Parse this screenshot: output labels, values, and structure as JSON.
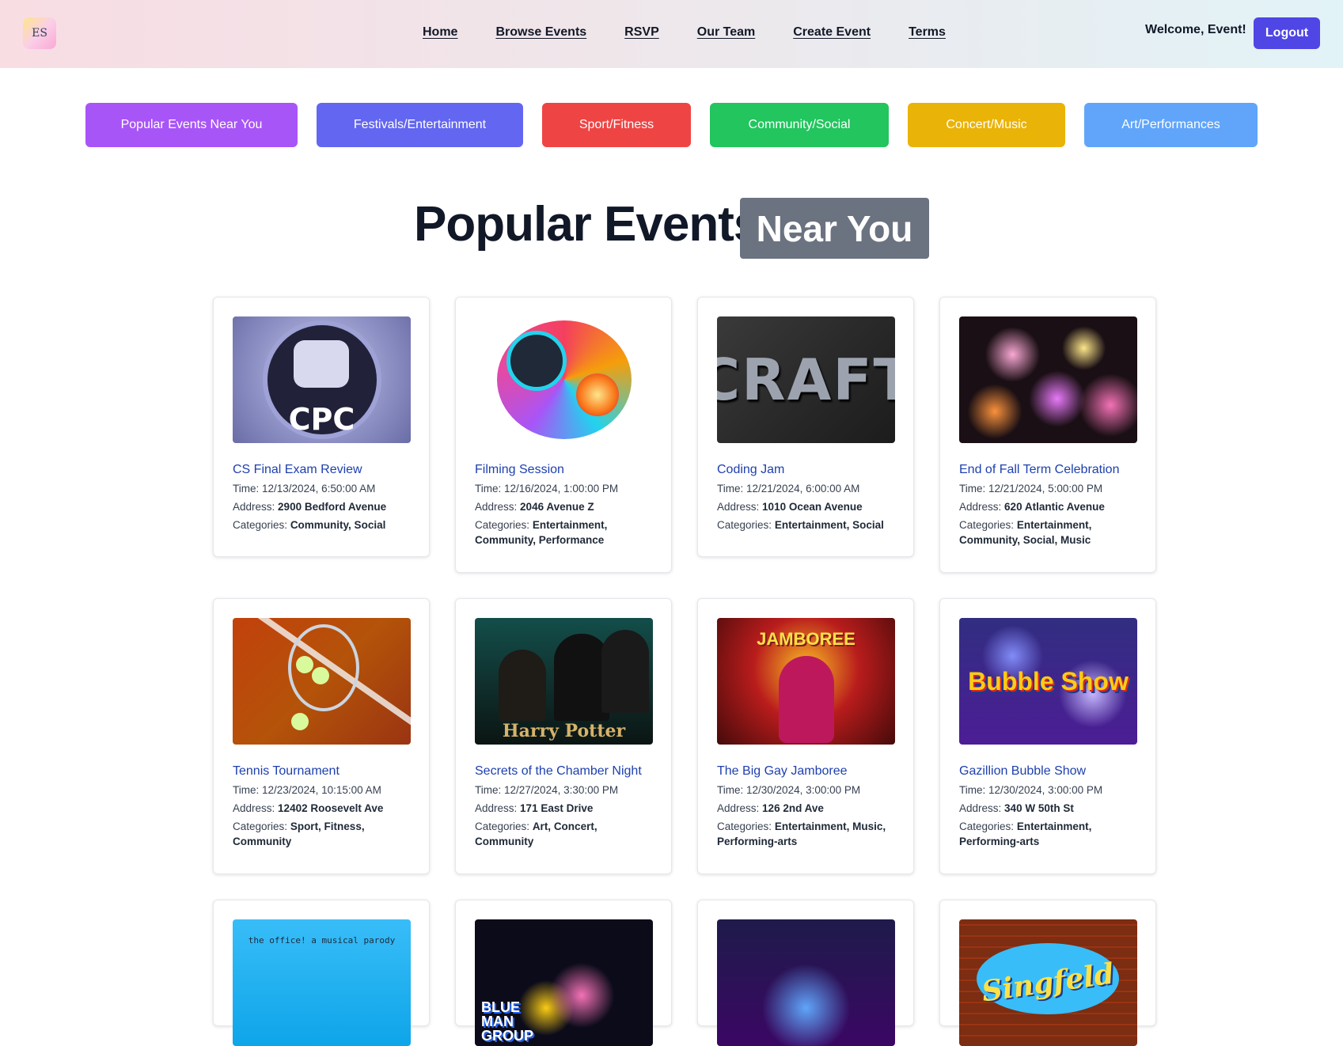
{
  "header": {
    "logo_text": "ES",
    "nav": [
      "Home",
      "Browse Events",
      "RSVP",
      "Our Team",
      "Create Event",
      "Terms"
    ],
    "welcome": "Welcome, Event!",
    "logout_label": "Logout"
  },
  "categories": [
    {
      "label": "Popular Events Near You",
      "color": "#a855f7"
    },
    {
      "label": "Festivals/Entertainment",
      "color": "#6366f1"
    },
    {
      "label": "Sport/Fitness",
      "color": "#ef4444"
    },
    {
      "label": "Community/Social",
      "color": "#22c55e"
    },
    {
      "label": "Concert/Music",
      "color": "#eab308"
    },
    {
      "label": "Art/Performances",
      "color": "#60a5fa"
    }
  ],
  "heading": {
    "main": "Popular Events",
    "badge": "Near You"
  },
  "labels": {
    "time": "Time:",
    "address": "Address:",
    "categories": "Categories:"
  },
  "events": [
    {
      "title": "CS Final Exam Review",
      "time": "12/13/2024, 6:50:00 AM",
      "address": "2900 Bedford Avenue",
      "categories": "Community, Social",
      "image_text": "CPC"
    },
    {
      "title": "Filming Session",
      "time": "12/16/2024, 1:00:00 PM",
      "address": "2046 Avenue Z",
      "categories": "Entertainment, Community, Performance",
      "image_text": ""
    },
    {
      "title": "Coding Jam",
      "time": "12/21/2024, 6:00:00 AM",
      "address": "1010 Ocean Avenue",
      "categories": "Entertainment, Social",
      "image_text": "CRAFT"
    },
    {
      "title": "End of Fall Term Celebration",
      "time": "12/21/2024, 5:00:00 PM",
      "address": "620 Atlantic Avenue",
      "categories": "Entertainment, Community, Social, Music",
      "image_text": ""
    },
    {
      "title": "Tennis Tournament",
      "time": "12/23/2024, 10:15:00 AM",
      "address": "12402 Roosevelt Ave",
      "categories": "Sport, Fitness, Community",
      "image_text": ""
    },
    {
      "title": "Secrets of the Chamber Night",
      "time": "12/27/2024, 3:30:00 PM",
      "address": "171 East Drive",
      "categories": "Art, Concert, Community",
      "image_text": "Harry Potter"
    },
    {
      "title": "The Big Gay Jamboree",
      "time": "12/30/2024, 3:00:00 PM",
      "address": "126 2nd Ave",
      "categories": "Entertainment, Music, Performing-arts",
      "image_text": "JAMBOREE"
    },
    {
      "title": "Gazillion Bubble Show",
      "time": "12/30/2024, 3:00:00 PM",
      "address": "340 W 50th St",
      "categories": "Entertainment, Performing-arts",
      "image_text": "Bubble Show"
    },
    {
      "title": "",
      "time": "",
      "address": "",
      "categories": "",
      "image_text": "the office! a musical parody"
    },
    {
      "title": "",
      "time": "",
      "address": "",
      "categories": "",
      "image_text": "BLUE MAN GROUP"
    },
    {
      "title": "",
      "time": "",
      "address": "",
      "categories": "",
      "image_text": ""
    },
    {
      "title": "",
      "time": "",
      "address": "",
      "categories": "",
      "image_text": "Singfeld"
    }
  ]
}
